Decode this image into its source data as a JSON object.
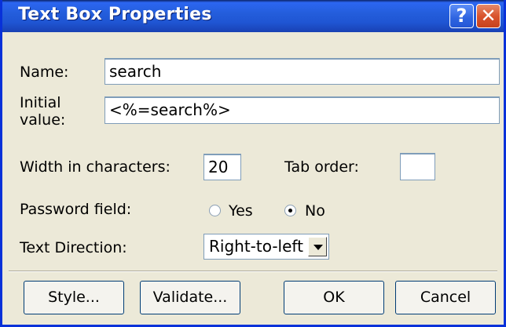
{
  "title": "Text Box Properties",
  "title_buttons": {
    "help": "?",
    "close": "✕"
  },
  "name": {
    "label": "Name:",
    "value": "search"
  },
  "initial_value": {
    "label_line1": "Initial",
    "label_line2": "value:",
    "value": "<%=search%>"
  },
  "width": {
    "label": "Width in characters:",
    "value": "20"
  },
  "tab_order": {
    "label": "Tab order:",
    "value": ""
  },
  "password": {
    "label": "Password field:",
    "options": [
      {
        "label": "Yes",
        "selected": false
      },
      {
        "label": "No",
        "selected": true
      }
    ]
  },
  "text_direction": {
    "label": "Text Direction:",
    "value": "Right-to-left"
  },
  "buttons": {
    "style": "Style...",
    "validate": "Validate...",
    "ok": "OK",
    "cancel": "Cancel"
  },
  "colors": {
    "titlebar": "#245EDC",
    "dialog_bg": "#ECE9D8",
    "close": "#D9542E"
  },
  "icons": {
    "help": "help-icon",
    "close": "close-icon",
    "dropdown": "chevron-down-icon"
  }
}
